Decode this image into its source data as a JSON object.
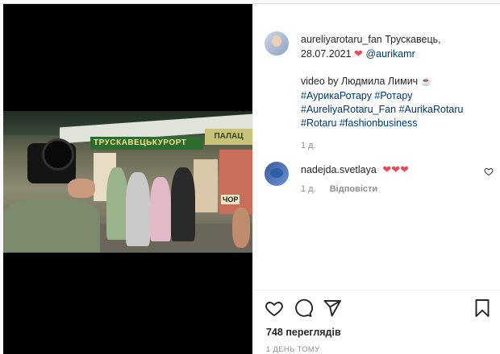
{
  "post": {
    "author": "aureliyarotaru_fan",
    "location": "Трускавець,",
    "date": "28.07.2021",
    "mention": "@aurikamr",
    "video_credit": "video by Людмила Лимич",
    "hashtags_line1": "#АурикаРотару #Ротару",
    "hashtags_line2": "#AureliyaRotaru_Fan #AurikaRotaru",
    "hashtags_line3": "#Rotaru #fashionbusiness",
    "caption_age": "1 д."
  },
  "video": {
    "banner_text": "ТРУСКАВЕЦЬКУРОРТ",
    "banner_right_text": "ПАЛАЦ",
    "sign_text": "ЧОР"
  },
  "comment": {
    "author": "nadejda.svetlaya",
    "hearts": "❤❤❤",
    "age": "1 д.",
    "reply_label": "Відповісти"
  },
  "footer": {
    "views": "748 переглядів",
    "posted_ago": "1 ДЕНЬ ТОМУ"
  },
  "icons": {
    "like": "heart-outline-icon",
    "comment": "comment-bubble-icon",
    "share": "paper-plane-icon",
    "save": "bookmark-icon"
  },
  "colors": {
    "accent_link": "#00376b",
    "heart_red": "#ed4956",
    "muted": "#8e8e8e",
    "text": "#262626"
  }
}
